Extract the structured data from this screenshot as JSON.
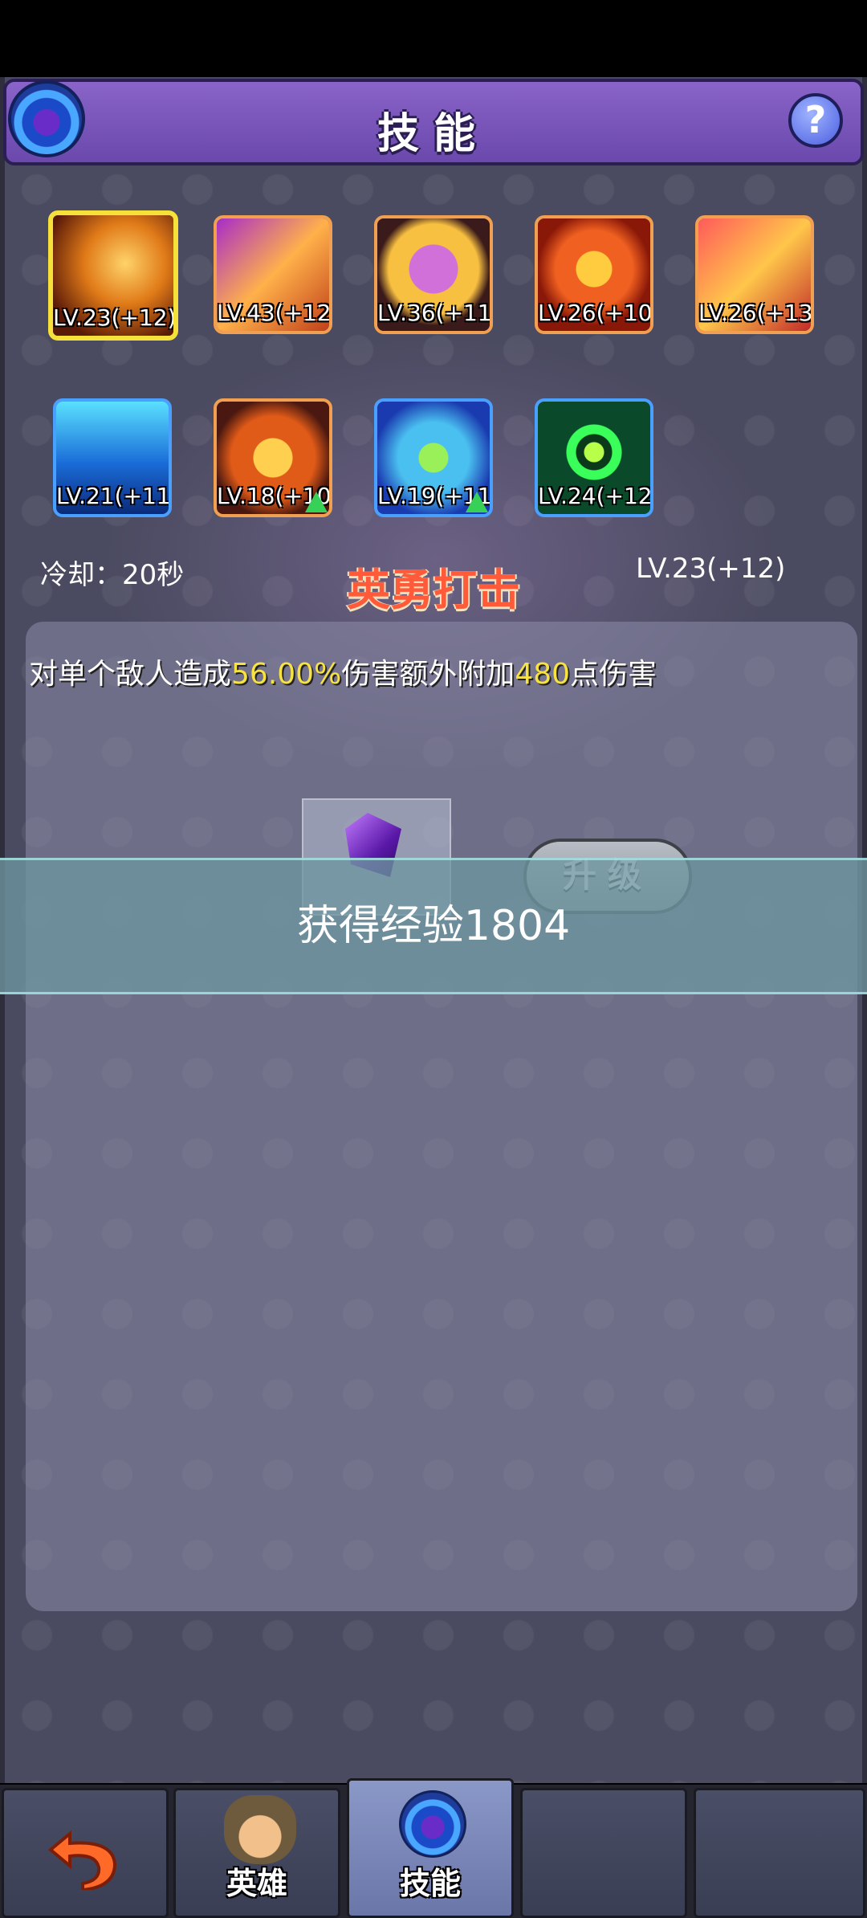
{
  "header": {
    "title": "技能",
    "help_label": "?"
  },
  "skills": [
    {
      "level": "LV.23(+12)",
      "selected": true,
      "frame": "gold",
      "upgradable": false
    },
    {
      "level": "LV.43(+12)",
      "selected": false,
      "frame": "orange",
      "upgradable": false
    },
    {
      "level": "LV.36(+11)",
      "selected": false,
      "frame": "orange",
      "upgradable": false
    },
    {
      "level": "LV.26(+10)",
      "selected": false,
      "frame": "orange",
      "upgradable": false
    },
    {
      "level": "LV.26(+13)",
      "selected": false,
      "frame": "orange",
      "upgradable": false
    },
    {
      "level": "LV.21(+11)",
      "selected": false,
      "frame": "blue",
      "upgradable": false
    },
    {
      "level": "LV.18(+10)",
      "selected": false,
      "frame": "orange",
      "upgradable": true
    },
    {
      "level": "LV.19(+11)",
      "selected": false,
      "frame": "blue",
      "upgradable": true
    },
    {
      "level": "LV.24(+12)",
      "selected": false,
      "frame": "blue",
      "upgradable": false
    }
  ],
  "detail": {
    "cooldown": "冷却：20秒",
    "name": "英勇打击",
    "level": "LV.23(+12)",
    "desc_parts": [
      "对单个敌人造成",
      "56.00%",
      "伤害额外附加",
      "480",
      "点伤害"
    ],
    "upgrade_label": "升级"
  },
  "toast": {
    "text": "获得经验1804"
  },
  "tabs": [
    {
      "label": "",
      "icon": "back-arrow-icon"
    },
    {
      "label": "英雄",
      "icon": "hero-icon"
    },
    {
      "label": "技能",
      "icon": "skill-orb-icon",
      "active": true
    },
    {
      "label": ""
    },
    {
      "label": ""
    }
  ],
  "colors": {
    "accent_purple": "#7a56bc",
    "highlight_yellow": "#f7e244",
    "skill_name_red": "#ff5b3a",
    "selected_frame": "#f6e13a"
  }
}
